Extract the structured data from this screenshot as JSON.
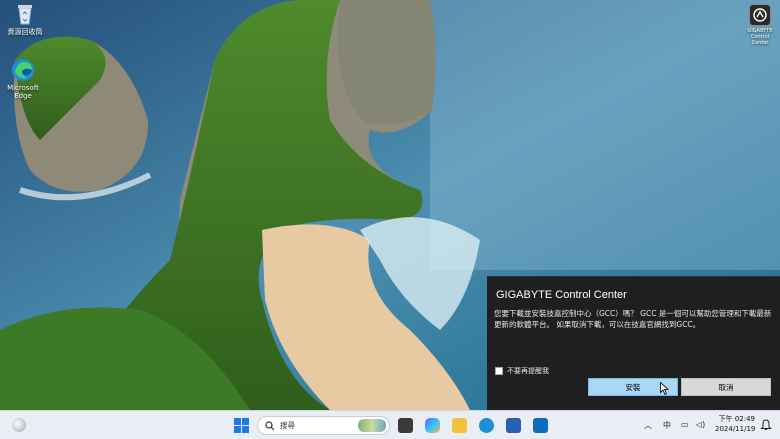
{
  "desktop": {
    "icons": [
      {
        "label": "資源回收筒"
      },
      {
        "label": "Microsoft Edge"
      }
    ],
    "top_right_label": "GIGABYTE Control Center"
  },
  "toast": {
    "title": "GIGABYTE Control Center",
    "body": "您要下載並安裝技嘉控制中心（GCC）嗎？ GCC 是一個可以幫助您管理和下載最新更新的軟體平台。 如果取消下載，可以在技嘉官網找到GCC。",
    "checkbox_label": "不要再提醒我",
    "install_label": "安裝",
    "cancel_label": "取消"
  },
  "taskbar": {
    "search_placeholder": "搜尋",
    "ime": "中",
    "time": "下午 02:49",
    "date": "2024/11/19"
  },
  "colors": {
    "toast_bg": "#1f1f1f",
    "install_btn": "#a9d7f5",
    "taskbar_bg": "#e9eef4",
    "accent": "#1c7ce0"
  }
}
